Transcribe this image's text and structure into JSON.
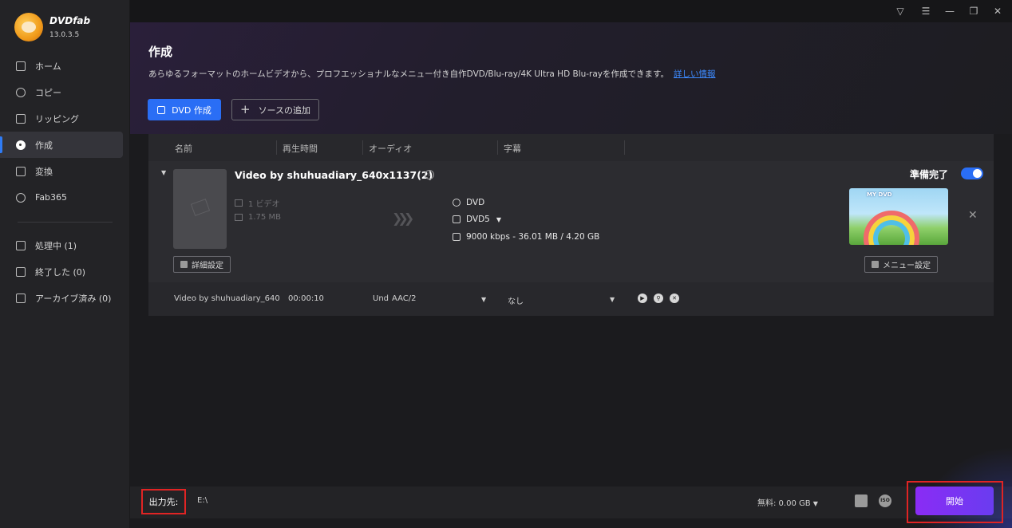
{
  "app": {
    "name": "DVDfab",
    "version": "13.0.3.5"
  },
  "sidebar": {
    "items": [
      {
        "label": "ホーム"
      },
      {
        "label": "コピー"
      },
      {
        "label": "リッピング"
      },
      {
        "label": "作成"
      },
      {
        "label": "変換"
      },
      {
        "label": "Fab365"
      }
    ],
    "queue": [
      {
        "label": "処理中 (1)"
      },
      {
        "label": "終了した (0)"
      },
      {
        "label": "アーカイブ済み (0)"
      }
    ]
  },
  "header": {
    "title": "作成",
    "description": "あらゆるフォーマットのホームビデオから、プロフエッショナルなメニュー付き自作DVD/Blu-ray/4K Ultra HD Blu-rayを作成できます。",
    "more_link": "詳しい情報",
    "primary_button": "DVD 作成",
    "add_source_button": "ソースの追加"
  },
  "table": {
    "columns": [
      "名前",
      "再生時間",
      "オーディオ",
      "字幕"
    ],
    "item": {
      "title": "Video by shuhuadiary_640x1137(2)",
      "video_count": "1 ビデオ",
      "size": "1.75 MB",
      "output_format": "DVD",
      "disc_type": "DVD5",
      "bitrate_info": "9000 kbps - 36.01 MB / 4.20 GB",
      "status": "準備完了",
      "advanced_button": "詳細設定",
      "menu_button": "メニュー設定",
      "menu_thumb_text": "MY DVD"
    },
    "track": {
      "name": "Video by shuhuadiary_640",
      "duration": "00:00:10",
      "audio_lang": "Und",
      "audio_codec": "AAC/2",
      "subtitle": "なし"
    }
  },
  "footer": {
    "output_label": "出力先:",
    "output_path": "E:\\",
    "free_space": "無料: 0.00 GB",
    "start_button": "開始",
    "iso_icon_text": "ISO"
  },
  "colors": {
    "accent": "#2a6ef5",
    "start": "#8a2cf5",
    "highlight": "#e02424"
  }
}
